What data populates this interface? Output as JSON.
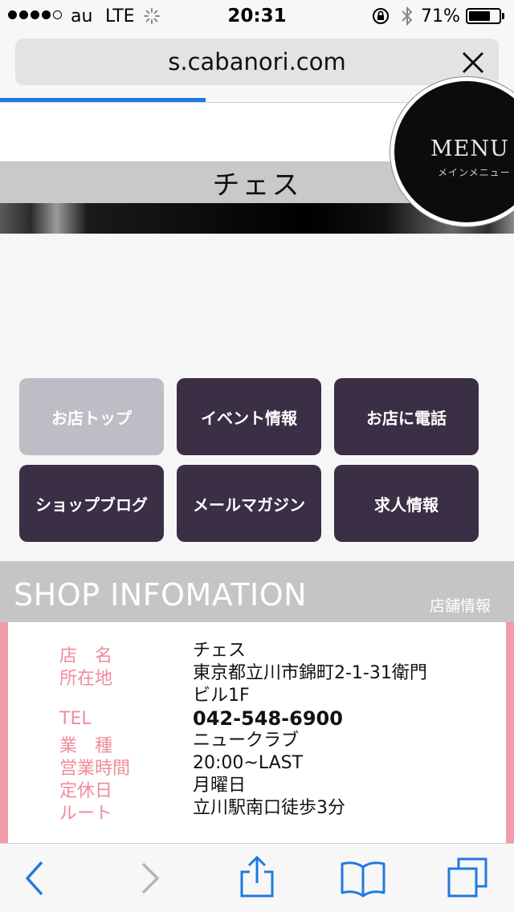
{
  "status_bar": {
    "carrier": "au",
    "network": "LTE",
    "time": "20:31",
    "battery_percent_text": "71%",
    "battery_level": 0.71
  },
  "browser": {
    "url": "s.cabanori.com",
    "load_progress": 0.4
  },
  "header": {
    "shop_name": "チェス",
    "menu_label": "MENU",
    "menu_sub": "メインメニュー"
  },
  "buttons": [
    {
      "label": "お店トップ"
    },
    {
      "label": "イベント情報"
    },
    {
      "label": "お店に電話"
    },
    {
      "label": "ショップブログ"
    },
    {
      "label": "メールマガジン"
    },
    {
      "label": "求人情報"
    }
  ],
  "shop_info": {
    "title": "SHOP INFOMATION",
    "subtitle": "店舗情報",
    "rows": [
      {
        "label": "店　名",
        "value": "チェス"
      },
      {
        "label": "所在地",
        "value": "東京都立川市錦町2-1-31衛門",
        "value2": "ビル1F"
      },
      {
        "label": "TEL",
        "value": "042-548-6900"
      },
      {
        "label": "業　種",
        "value": "ニュークラブ"
      },
      {
        "label": "営業時間",
        "value": "20:00~LAST"
      },
      {
        "label": "定休日",
        "value": "月曜日"
      },
      {
        "label": "ルート",
        "value": "立川駅南口徒歩3分"
      }
    ]
  },
  "icons": {
    "back": "chevron-left-icon",
    "forward": "chevron-right-icon",
    "share": "share-icon",
    "bookmarks": "book-icon",
    "tabs": "tabs-icon",
    "accent": "#1f7ae0"
  }
}
